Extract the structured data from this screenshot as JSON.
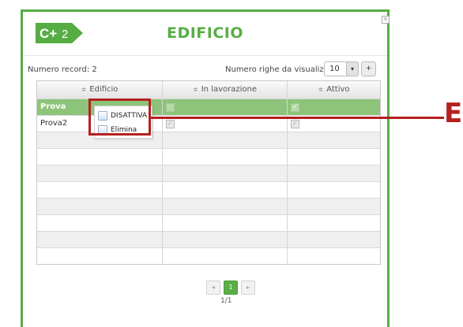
{
  "logo": {
    "text": "C+",
    "suffix": "2"
  },
  "title": "EDIFICIO",
  "close_glyph": "×",
  "record": {
    "label": "Numero record: 2"
  },
  "rows": {
    "label": "Numero righe da visualizzare:",
    "value": "10",
    "caret": "▾",
    "plus": "+"
  },
  "grid": {
    "headers": [
      "Edificio",
      "In lavorazione",
      "Attivo"
    ],
    "sort_icon": "≑",
    "rows": [
      {
        "edificio": "Prova",
        "in_lavorazione": false,
        "attivo": true
      },
      {
        "edificio": "Prova2",
        "in_lavorazione": true,
        "attivo": true
      }
    ],
    "check_glyph": "✓",
    "empty_rows": 8
  },
  "context_menu": {
    "items": [
      "DISATTIVA",
      "Elimina"
    ]
  },
  "callout": {
    "letter": "E"
  },
  "pager": {
    "prev": "◂",
    "page": "1",
    "next": "▸",
    "info": "1/1"
  },
  "colors": {
    "brand_green": "#56ad43",
    "selected_row": "#8dc47a",
    "callout_red": "#b5201f"
  }
}
